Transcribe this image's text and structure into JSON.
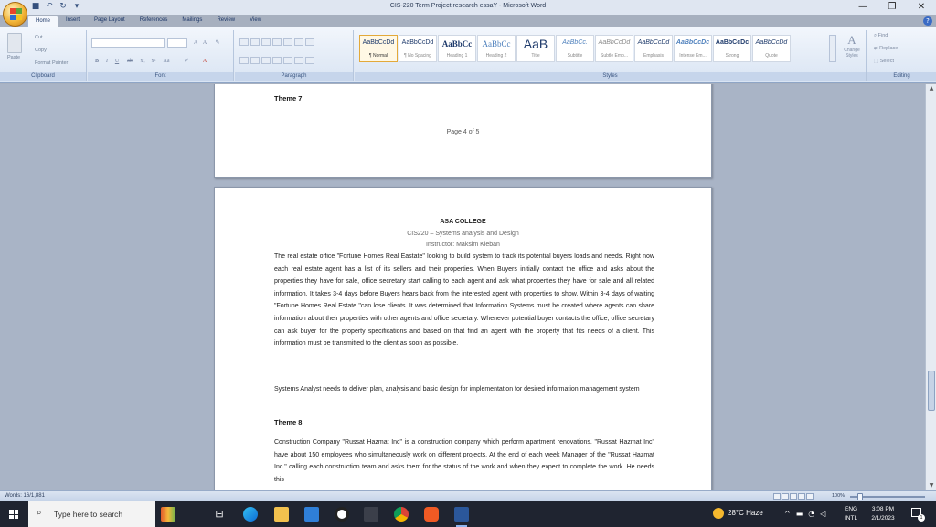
{
  "window": {
    "title": "CIS-220 Term Project research essaY - Microsoft Word",
    "controls": [
      "—",
      "❐",
      "✕"
    ]
  },
  "ribbon_tabs": [
    "Home",
    "Insert",
    "Page Layout",
    "References",
    "Mailings",
    "Review",
    "View"
  ],
  "clipboard": {
    "paste": "Paste",
    "cut": "Cut",
    "copy": "Copy",
    "format_painter": "Format Painter",
    "label": "Clipboard"
  },
  "font_group": {
    "label": "Font"
  },
  "paragraph_group": {
    "label": "Paragraph"
  },
  "styles_group": {
    "label": "Styles",
    "items": [
      {
        "sample": "AaBbCcDd",
        "name": "¶ Normal"
      },
      {
        "sample": "AaBbCcDd",
        "name": "¶ No Spacing"
      },
      {
        "sample": "AaBbCc",
        "name": "Heading 1"
      },
      {
        "sample": "AaBbCc",
        "name": "Heading 2"
      },
      {
        "sample": "AaB",
        "name": "Title"
      },
      {
        "sample": "AaBbCc.",
        "name": "Subtitle"
      },
      {
        "sample": "AaBbCcDd",
        "name": "Subtle Emp..."
      },
      {
        "sample": "AaBbCcDd",
        "name": "Emphasis"
      },
      {
        "sample": "AaBbCcDc",
        "name": "Intense Em..."
      },
      {
        "sample": "AaBbCcDc",
        "name": "Strong"
      },
      {
        "sample": "AaBbCcDd",
        "name": "Quote"
      }
    ],
    "change_styles": "Change Styles"
  },
  "editing_group": {
    "find": "Find",
    "replace": "Replace",
    "select": "Select",
    "label": "Editing"
  },
  "page1": {
    "heading": "Theme 7",
    "page_number": "Page 4 of 5"
  },
  "page2": {
    "college": "ASA COLLEGE",
    "course": "CIS220 – Systems analysis and Design",
    "instructor": "Instructor: Maksim Kleban",
    "para1": "The real estate office \"Fortune Homes Real Eastate\" looking to build system to track its potential buyers loads and needs. Right now each real estate agent has a list of its sellers and their properties. When Buyers initially contact the office and asks about the properties they have for sale, office secretary start calling to each agent and ask what properties they have for sale and all related information. It takes 3-4 days before Buyers hears back from the interested agent with properties to show. Within 3-4 days of waiting \"Fortune Homes Real Estate \"can lose clients. It was determined that Information Systems must be created where agents can share information about their properties with other agents and office secretary. Whenever potential buyer contacts the office, office secretary can ask buyer for the property specifications and based on that find an agent with the property that fits needs of a client. This information must be transmitted to the client as soon as possible.",
    "para2": "Systems Analyst needs to deliver plan, analysis and basic design for implementation for desired information management system",
    "heading": "Theme 8",
    "para3": "Construction Company \"Russat Hazmat Inc\" is a construction company which perform apartment renovations. \"Russat Hazmat Inc\" have about 150 employees who simultaneously work on different projects. At the end of each week Manager of the \"Russat Hazmat Inc.\" calling each construction team and asks them for the status of the work and when they expect to complete the work. He needs this"
  },
  "status": {
    "words": "Words: 16/1,881",
    "zoom": "100%"
  },
  "taskbar": {
    "search_placeholder": "Type here to search",
    "weather": "28°C Haze",
    "lang_top": "ENG",
    "lang_bottom": "INTL",
    "time": "3:08 PM",
    "date": "2/1/2023",
    "notification_count": "1"
  },
  "colors": {
    "accent": "#2b579a",
    "taskbar": "#1f2430",
    "ribbon": "#dbe5f3"
  }
}
